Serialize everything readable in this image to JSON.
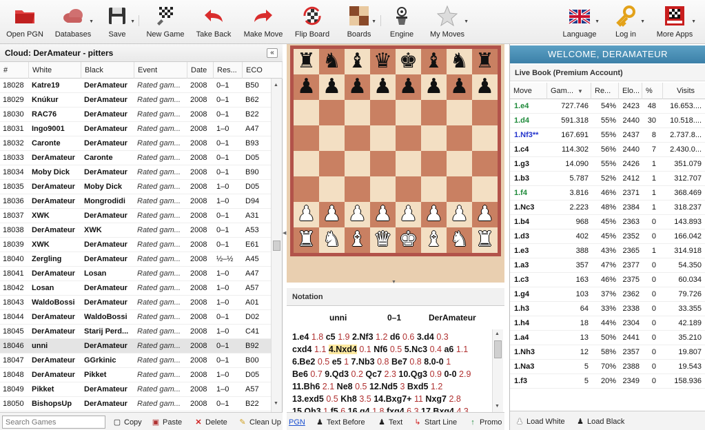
{
  "toolbar": {
    "items": [
      {
        "label": "Open PGN",
        "icon": "folder-icon"
      },
      {
        "label": "Databases",
        "icon": "cloud-icon"
      },
      {
        "label": "Save",
        "icon": "floppy-icon"
      },
      {
        "label": "New Game",
        "icon": "new-game-icon"
      },
      {
        "label": "Take Back",
        "icon": "undo-arrow-icon"
      },
      {
        "label": "Make Move",
        "icon": "redo-arrow-icon"
      },
      {
        "label": "Flip Board",
        "icon": "flip-board-icon"
      },
      {
        "label": "Boards",
        "icon": "boards-icon"
      },
      {
        "label": "Engine",
        "icon": "engine-icon"
      },
      {
        "label": "My Moves",
        "icon": "star-icon"
      },
      {
        "label": "Language",
        "icon": "uk-flag-icon"
      },
      {
        "label": "Log in",
        "icon": "key-icon"
      },
      {
        "label": "More Apps",
        "icon": "chessbase-icon"
      }
    ]
  },
  "games_panel": {
    "title": "Cloud: DerAmateur - pitters",
    "columns": [
      "#",
      "White",
      "Black",
      "Event",
      "Date",
      "Res...",
      "ECO"
    ],
    "rows": [
      [
        "18028",
        "Katre19",
        "DerAmateur",
        "Rated gam...",
        "2008",
        "0–1",
        "B50"
      ],
      [
        "18029",
        "Knúkur",
        "DerAmateur",
        "Rated gam...",
        "2008",
        "0–1",
        "B62"
      ],
      [
        "18030",
        "RAC76",
        "DerAmateur",
        "Rated gam...",
        "2008",
        "0–1",
        "B22"
      ],
      [
        "18031",
        "Ingo9001",
        "DerAmateur",
        "Rated gam...",
        "2008",
        "1–0",
        "A47"
      ],
      [
        "18032",
        "Caronte",
        "DerAmateur",
        "Rated gam...",
        "2008",
        "0–1",
        "B93"
      ],
      [
        "18033",
        "DerAmateur",
        "Caronte",
        "Rated gam...",
        "2008",
        "0–1",
        "D05"
      ],
      [
        "18034",
        "Moby Dick",
        "DerAmateur",
        "Rated gam...",
        "2008",
        "0–1",
        "B90"
      ],
      [
        "18035",
        "DerAmateur",
        "Moby Dick",
        "Rated gam...",
        "2008",
        "1–0",
        "D05"
      ],
      [
        "18036",
        "DerAmateur",
        "Mongrodidi",
        "Rated gam...",
        "2008",
        "1–0",
        "D94"
      ],
      [
        "18037",
        "XWK",
        "DerAmateur",
        "Rated gam...",
        "2008",
        "0–1",
        "A31"
      ],
      [
        "18038",
        "DerAmateur",
        "XWK",
        "Rated gam...",
        "2008",
        "0–1",
        "A53"
      ],
      [
        "18039",
        "XWK",
        "DerAmateur",
        "Rated gam...",
        "2008",
        "0–1",
        "E61"
      ],
      [
        "18040",
        "Zergling",
        "DerAmateur",
        "Rated gam...",
        "2008",
        "½–½",
        "A45"
      ],
      [
        "18041",
        "DerAmateur",
        "Losan",
        "Rated gam...",
        "2008",
        "1–0",
        "A47"
      ],
      [
        "18042",
        "Losan",
        "DerAmateur",
        "Rated gam...",
        "2008",
        "1–0",
        "A57"
      ],
      [
        "18043",
        "WaldoBossi",
        "DerAmateur",
        "Rated gam...",
        "2008",
        "1–0",
        "A01"
      ],
      [
        "18044",
        "DerAmateur",
        "WaldoBossi",
        "Rated gam...",
        "2008",
        "0–1",
        "D02"
      ],
      [
        "18045",
        "DerAmateur",
        "Starij Perd...",
        "Rated gam...",
        "2008",
        "1–0",
        "C41"
      ],
      [
        "18046",
        "unni",
        "DerAmateur",
        "Rated gam...",
        "2008",
        "0–1",
        "B92"
      ],
      [
        "18047",
        "DerAmateur",
        "GGrkinic",
        "Rated gam...",
        "2008",
        "0–1",
        "B00"
      ],
      [
        "18048",
        "DerAmateur",
        "Pikket",
        "Rated gam...",
        "2008",
        "1–0",
        "D05"
      ],
      [
        "18049",
        "Pikket",
        "DerAmateur",
        "Rated gam...",
        "2008",
        "1–0",
        "A57"
      ],
      [
        "18050",
        "BishopsUp",
        "DerAmateur",
        "Rated gam...",
        "2008",
        "0–1",
        "B22"
      ]
    ],
    "selected_index": 18,
    "search_placeholder": "Search Games",
    "footer_buttons": [
      {
        "label": "Copy",
        "icon": "copy-icon"
      },
      {
        "label": "Paste",
        "icon": "paste-icon"
      },
      {
        "label": "Delete",
        "icon": "delete-x-icon"
      },
      {
        "label": "Clean Up",
        "icon": "broom-icon"
      }
    ]
  },
  "board": {
    "ranks": [
      "rnbqkbnr",
      "pppppppp",
      "........",
      "........",
      "........",
      "........",
      "PPPPPPPP",
      "RNBQKBNR"
    ]
  },
  "notation": {
    "title": "Notation",
    "white": "unni",
    "result": "0–1",
    "black": "DerAmateur",
    "lines": [
      [
        [
          "m",
          "1.e4"
        ],
        [
          "e",
          "1.8"
        ],
        [
          "m",
          "c5"
        ],
        [
          "e",
          "1.9"
        ],
        [
          "m",
          "2.Nf3"
        ],
        [
          "e",
          "1.2"
        ],
        [
          "m",
          "d6"
        ],
        [
          "e",
          "0.6"
        ],
        [
          "m",
          "3.d4"
        ],
        [
          "e",
          "0.3"
        ]
      ],
      [
        [
          "m",
          "cxd4"
        ],
        [
          "e",
          "1.1"
        ],
        [
          "c",
          "4.Nxd4"
        ],
        [
          "e",
          "0.1"
        ],
        [
          "m",
          "Nf6"
        ],
        [
          "e",
          "0.5"
        ],
        [
          "m",
          "5.Nc3"
        ],
        [
          "e",
          "0.4"
        ],
        [
          "m",
          "a6"
        ],
        [
          "e",
          "1.1"
        ]
      ],
      [
        [
          "m",
          "6.Be2"
        ],
        [
          "e",
          "0.5"
        ],
        [
          "m",
          "e5"
        ],
        [
          "e",
          "1"
        ],
        [
          "m",
          "7.Nb3"
        ],
        [
          "e",
          "0.8"
        ],
        [
          "m",
          "Be7"
        ],
        [
          "e",
          "0.8"
        ],
        [
          "m",
          "8.0-0"
        ],
        [
          "e",
          "1"
        ]
      ],
      [
        [
          "m",
          "Be6"
        ],
        [
          "e",
          "0.7"
        ],
        [
          "m",
          "9.Qd3"
        ],
        [
          "e",
          "0.2"
        ],
        [
          "m",
          "Qc7"
        ],
        [
          "e",
          "2.3"
        ],
        [
          "m",
          "10.Qg3"
        ],
        [
          "e",
          "0.9"
        ],
        [
          "m",
          "0-0"
        ],
        [
          "e",
          "2.9"
        ]
      ],
      [
        [
          "m",
          "11.Bh6"
        ],
        [
          "e",
          "2.1"
        ],
        [
          "m",
          "Ne8"
        ],
        [
          "e",
          "0.5"
        ],
        [
          "m",
          "12.Nd5"
        ],
        [
          "e",
          "3"
        ],
        [
          "m",
          "Bxd5"
        ],
        [
          "e",
          "1.2"
        ]
      ],
      [
        [
          "m",
          "13.exd5"
        ],
        [
          "e",
          "0.5"
        ],
        [
          "m",
          "Kh8"
        ],
        [
          "e",
          "3.5"
        ],
        [
          "m",
          "14.Bxg7+"
        ],
        [
          "e",
          "11"
        ],
        [
          "m",
          "Nxg7"
        ],
        [
          "e",
          "2.8"
        ]
      ],
      [
        [
          "m",
          "15.Qh3"
        ],
        [
          "e",
          "1"
        ],
        [
          "m",
          "f5"
        ],
        [
          "e",
          "6"
        ],
        [
          "m",
          "16.g4"
        ],
        [
          "e",
          "1.8"
        ],
        [
          "m",
          "fxg4"
        ],
        [
          "e",
          "6.3"
        ],
        [
          "m",
          "17.Bxg4"
        ],
        [
          "e",
          "4.3"
        ]
      ]
    ],
    "footer_buttons": [
      {
        "label": "PGN",
        "icon": ""
      },
      {
        "label": "Text Before",
        "icon": "pawn-icon"
      },
      {
        "label": "Text",
        "icon": "pawn-icon"
      },
      {
        "label": "Start Line",
        "icon": "start-line-icon"
      },
      {
        "label": "Promo",
        "icon": "promote-arrow-icon"
      }
    ]
  },
  "livebook": {
    "welcome": "WELCOME, DERAMATEUR",
    "title": "Live Book (Premium Account)",
    "columns": [
      "Move",
      "Gam...",
      "Re...",
      "Elo...",
      "%",
      "Visits"
    ],
    "rows": [
      {
        "move": "1.e4",
        "color": "#1e8a3a",
        "games": "727.746",
        "res": "54%",
        "elo": "2423",
        "pct": "48",
        "visits": "16.653...."
      },
      {
        "move": "1.d4",
        "color": "#1e8a3a",
        "games": "591.318",
        "res": "55%",
        "elo": "2440",
        "pct": "30",
        "visits": "10.518...."
      },
      {
        "move": "1.Nf3**",
        "color": "#2233cc",
        "games": "167.691",
        "res": "55%",
        "elo": "2437",
        "pct": "8",
        "visits": "2.737.8..."
      },
      {
        "move": "1.c4",
        "color": "#111111",
        "games": "114.302",
        "res": "56%",
        "elo": "2440",
        "pct": "7",
        "visits": "2.430.0..."
      },
      {
        "move": "1.g3",
        "color": "#111111",
        "games": "14.090",
        "res": "55%",
        "elo": "2426",
        "pct": "1",
        "visits": "351.079"
      },
      {
        "move": "1.b3",
        "color": "#111111",
        "games": "5.787",
        "res": "52%",
        "elo": "2412",
        "pct": "1",
        "visits": "312.707"
      },
      {
        "move": "1.f4",
        "color": "#1e8a3a",
        "games": "3.816",
        "res": "46%",
        "elo": "2371",
        "pct": "1",
        "visits": "368.469"
      },
      {
        "move": "1.Nc3",
        "color": "#111111",
        "games": "2.223",
        "res": "48%",
        "elo": "2384",
        "pct": "1",
        "visits": "318.237"
      },
      {
        "move": "1.b4",
        "color": "#111111",
        "games": "968",
        "res": "45%",
        "elo": "2363",
        "pct": "0",
        "visits": "143.893"
      },
      {
        "move": "1.d3",
        "color": "#111111",
        "games": "402",
        "res": "45%",
        "elo": "2352",
        "pct": "0",
        "visits": "166.042"
      },
      {
        "move": "1.e3",
        "color": "#111111",
        "games": "388",
        "res": "43%",
        "elo": "2365",
        "pct": "1",
        "visits": "314.918"
      },
      {
        "move": "1.a3",
        "color": "#111111",
        "games": "357",
        "res": "47%",
        "elo": "2377",
        "pct": "0",
        "visits": "54.350"
      },
      {
        "move": "1.c3",
        "color": "#111111",
        "games": "163",
        "res": "46%",
        "elo": "2375",
        "pct": "0",
        "visits": "60.034"
      },
      {
        "move": "1.g4",
        "color": "#111111",
        "games": "103",
        "res": "37%",
        "elo": "2362",
        "pct": "0",
        "visits": "79.726"
      },
      {
        "move": "1.h3",
        "color": "#111111",
        "games": "64",
        "res": "33%",
        "elo": "2338",
        "pct": "0",
        "visits": "33.355"
      },
      {
        "move": "1.h4",
        "color": "#111111",
        "games": "18",
        "res": "44%",
        "elo": "2304",
        "pct": "0",
        "visits": "42.189"
      },
      {
        "move": "1.a4",
        "color": "#111111",
        "games": "13",
        "res": "50%",
        "elo": "2441",
        "pct": "0",
        "visits": "35.210"
      },
      {
        "move": "1.Nh3",
        "color": "#111111",
        "games": "12",
        "res": "58%",
        "elo": "2357",
        "pct": "0",
        "visits": "19.807"
      },
      {
        "move": "1.Na3",
        "color": "#111111",
        "games": "5",
        "res": "70%",
        "elo": "2388",
        "pct": "0",
        "visits": "19.543"
      },
      {
        "move": "1.f3",
        "color": "#111111",
        "games": "5",
        "res": "20%",
        "elo": "2349",
        "pct": "0",
        "visits": "158.936"
      }
    ],
    "footer_buttons": [
      {
        "label": "Load White",
        "icon": "white-pawn-icon"
      },
      {
        "label": "Load Black",
        "icon": "black-pawn-icon"
      }
    ]
  }
}
